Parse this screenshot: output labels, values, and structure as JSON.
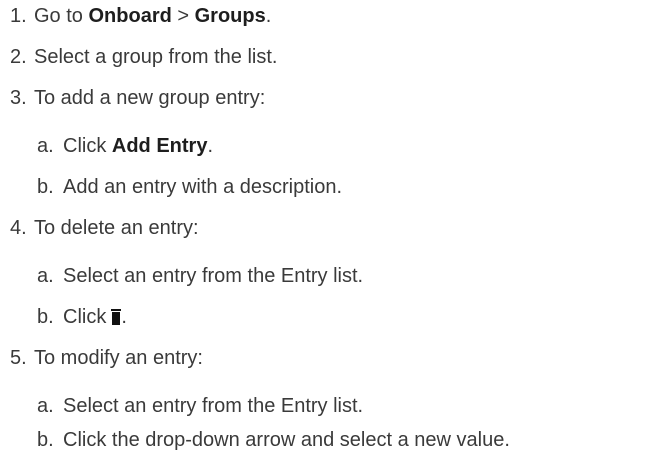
{
  "steps": [
    {
      "num": "1.",
      "pre": "Go to ",
      "bold1": "Onboard",
      "mid": " > ",
      "bold2": "Groups",
      "post": "."
    },
    {
      "num": "2.",
      "text": "Select a group from the list."
    },
    {
      "num": "3.",
      "text": "To add a new group entry:"
    },
    {
      "num": "a.",
      "pre": "Click ",
      "bold": "Add Entry",
      "post": "."
    },
    {
      "num": "b.",
      "text": "Add an entry with a description."
    },
    {
      "num": "4.",
      "text": "To delete an entry:"
    },
    {
      "num": "a.",
      "text": "Select an entry from the Entry list."
    },
    {
      "num": "b.",
      "pre": "Click",
      "icon": "trash-icon",
      "post": "."
    },
    {
      "num": "5.",
      "text": "To modify an entry:"
    },
    {
      "num": "a.",
      "text": "Select an entry from the Entry list."
    },
    {
      "num": "b.",
      "text": "Click the drop-down arrow and select a new value."
    }
  ],
  "icon_color": "#111111",
  "text_color": "#3a3a3a"
}
